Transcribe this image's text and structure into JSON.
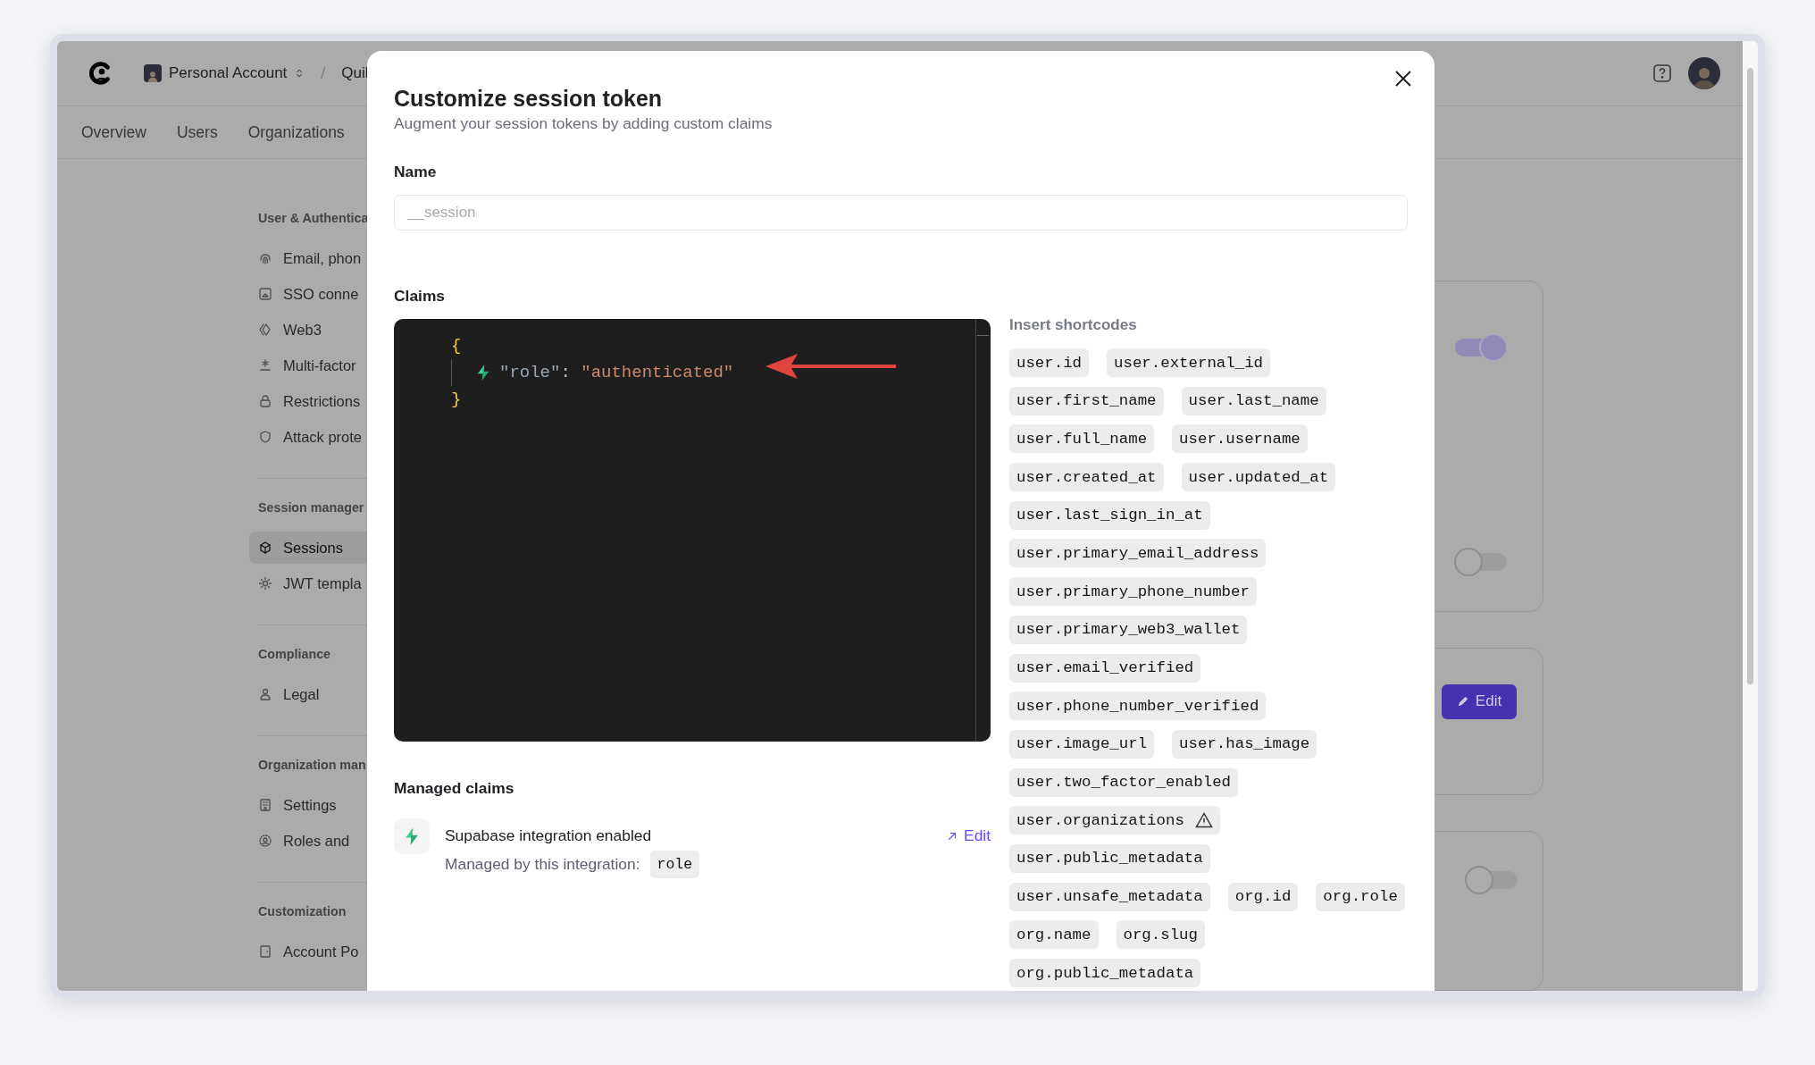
{
  "header": {
    "account": "Personal Account",
    "separator": "/",
    "breadcrumb": "Quil"
  },
  "nav_tabs": [
    "Overview",
    "Users",
    "Organizations"
  ],
  "sidebar": [
    {
      "title": "User & Authentica",
      "items": [
        {
          "label": "Email, phon",
          "selected": false
        },
        {
          "label": "SSO conne",
          "selected": false
        },
        {
          "label": "Web3",
          "selected": false
        },
        {
          "label": "Multi-factor",
          "selected": false
        },
        {
          "label": "Restrictions",
          "selected": false
        },
        {
          "label": "Attack prote",
          "selected": false
        }
      ]
    },
    {
      "title": "Session manager",
      "items": [
        {
          "label": "Sessions",
          "selected": true
        },
        {
          "label": "JWT templa",
          "selected": false
        }
      ]
    },
    {
      "title": "Compliance",
      "items": [
        {
          "label": "Legal",
          "selected": false
        }
      ]
    },
    {
      "title": "Organization man",
      "items": [
        {
          "label": "Settings",
          "selected": false
        },
        {
          "label": "Roles and",
          "selected": false
        }
      ]
    },
    {
      "title": "Customization",
      "items": [
        {
          "label": "Account Po",
          "selected": false
        }
      ]
    }
  ],
  "cards": [
    {
      "kind": "toggles",
      "toggles": [
        {
          "on": true
        },
        {
          "on": false
        }
      ]
    },
    {
      "kind": "button",
      "button": "Edit"
    },
    {
      "kind": "toggles",
      "toggles": [
        {
          "on": false
        }
      ]
    }
  ],
  "modal": {
    "title": "Customize session token",
    "subtitle": "Augment your session tokens by adding custom claims",
    "name_label": "Name",
    "name_field": {
      "placeholder": "__session"
    },
    "claims_label": "Claims",
    "code_lines": [
      {
        "managed": false,
        "indented": false,
        "tokens": [
          {
            "kind": "brace",
            "text": "{"
          }
        ]
      },
      {
        "managed": true,
        "indented": true,
        "tokens": [
          {
            "kind": "key",
            "text": "\"role\""
          },
          {
            "kind": "punct",
            "text": ": "
          },
          {
            "kind": "string",
            "text": "\"authenticated\""
          }
        ]
      },
      {
        "managed": false,
        "indented": false,
        "tokens": [
          {
            "kind": "brace",
            "text": "}"
          }
        ]
      }
    ],
    "shortcodes_heading": "Insert shortcodes",
    "shortcode_rows": [
      [
        {
          "code": "user.id",
          "warning": false
        },
        {
          "code": "user.external_id",
          "warning": false
        }
      ],
      [
        {
          "code": "user.first_name",
          "warning": false
        },
        {
          "code": "user.last_name",
          "warning": false
        }
      ],
      [
        {
          "code": "user.full_name",
          "warning": false
        },
        {
          "code": "user.username",
          "warning": false
        }
      ],
      [
        {
          "code": "user.created_at",
          "warning": false
        },
        {
          "code": "user.updated_at",
          "warning": false
        }
      ],
      [
        {
          "code": "user.last_sign_in_at",
          "warning": false
        }
      ],
      [
        {
          "code": "user.primary_email_address",
          "warning": false
        }
      ],
      [
        {
          "code": "user.primary_phone_number",
          "warning": false
        }
      ],
      [
        {
          "code": "user.primary_web3_wallet",
          "warning": false
        }
      ],
      [
        {
          "code": "user.email_verified",
          "warning": false
        }
      ],
      [
        {
          "code": "user.phone_number_verified",
          "warning": false
        }
      ],
      [
        {
          "code": "user.image_url",
          "warning": false
        },
        {
          "code": "user.has_image",
          "warning": false
        }
      ],
      [
        {
          "code": "user.two_factor_enabled",
          "warning": false
        }
      ],
      [
        {
          "code": "user.organizations",
          "warning": true
        }
      ],
      [
        {
          "code": "user.public_metadata",
          "warning": false
        }
      ],
      [
        {
          "code": "user.unsafe_metadata",
          "warning": false
        },
        {
          "code": "org.id",
          "warning": false
        },
        {
          "code": "org.role",
          "warning": false
        }
      ],
      [
        {
          "code": "org.name",
          "warning": false
        },
        {
          "code": "org.slug",
          "warning": false
        }
      ],
      [
        {
          "code": "org.public_metadata",
          "warning": false
        }
      ]
    ],
    "managed_claims": {
      "heading": "Managed claims",
      "integration": "Supabase integration enabled",
      "managed_by": "Managed by this integration:",
      "claim": "role",
      "edit_link": "Edit"
    }
  }
}
